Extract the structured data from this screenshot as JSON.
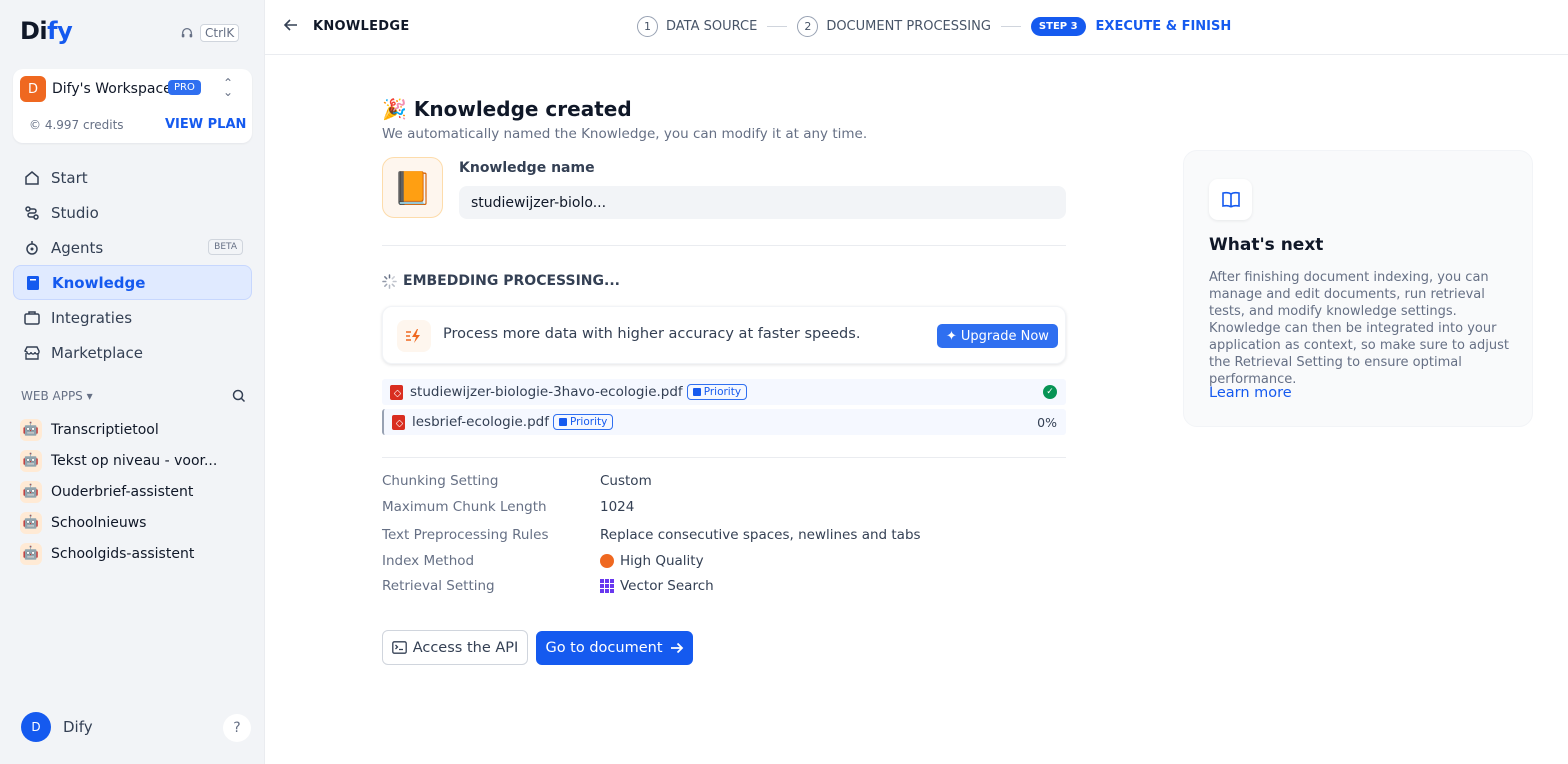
{
  "sidebar": {
    "logo": {
      "part1": "Di",
      "part2": "fy"
    },
    "shortcut": "CtrlK",
    "workspace": {
      "avatar": "D",
      "name": "Dify's Workspace",
      "plan": "PRO",
      "credits": "4.997 credits",
      "view_plan": "VIEW PLAN"
    },
    "nav": [
      {
        "label": "Start",
        "icon": "home-icon"
      },
      {
        "label": "Studio",
        "icon": "studio-icon"
      },
      {
        "label": "Agents",
        "icon": "agent-icon",
        "badge": "BETA"
      },
      {
        "label": "Knowledge",
        "icon": "book-icon",
        "active": true
      },
      {
        "label": "Integraties",
        "icon": "briefcase-icon"
      },
      {
        "label": "Marketplace",
        "icon": "store-icon"
      }
    ],
    "web_apps_header": "WEB APPS",
    "web_apps": [
      {
        "label": "Transcriptietool",
        "icon": "robot-emoji"
      },
      {
        "label": "Tekst op niveau - voor...",
        "icon": "robot-emoji"
      },
      {
        "label": "Ouderbrief-assistent",
        "icon": "robot-emoji"
      },
      {
        "label": "Schoolnieuws",
        "icon": "robot-emoji"
      },
      {
        "label": "Schoolgids-assistent",
        "icon": "robot-emoji"
      }
    ],
    "user": {
      "avatar": "D",
      "name": "Dify"
    },
    "help": "?"
  },
  "topbar": {
    "back_title": "KNOWLEDGE",
    "steps": [
      {
        "num": "1",
        "label": "DATA SOURCE"
      },
      {
        "num": "2",
        "label": "DOCUMENT PROCESSING"
      }
    ],
    "active_step": {
      "badge": "STEP 3",
      "label": "EXECUTE & FINISH"
    }
  },
  "main": {
    "title_emoji": "🎉",
    "title": "Knowledge created",
    "subtitle": "We automatically named the Knowledge, you can modify it at any time.",
    "knowledge_icon": "📙",
    "knowledge_name_label": "Knowledge name",
    "knowledge_name_value": "studiewijzer-biolo...",
    "embedding_title": "EMBEDDING PROCESSING...",
    "upgrade": {
      "text": "Process more data with higher accuracy at faster speeds.",
      "button": "Upgrade Now"
    },
    "files": [
      {
        "name": "studiewijzer-biologie-3havo-ecologie.pdf",
        "badge": "Priority",
        "status": "done"
      },
      {
        "name": "lesbrief-ecologie.pdf",
        "badge": "Priority",
        "status": "0%"
      }
    ],
    "settings": [
      {
        "key": "Chunking Setting",
        "value": "Custom"
      },
      {
        "key": "Maximum Chunk Length",
        "value": "1024"
      },
      {
        "key": "Text Preprocessing Rules",
        "value": "Replace consecutive spaces, newlines and tabs"
      },
      {
        "key": "Index Method",
        "value": "High Quality"
      },
      {
        "key": "Retrieval Setting",
        "value": "Vector Search"
      }
    ],
    "btn_api": "Access the API",
    "btn_doc": "Go to document"
  },
  "next_panel": {
    "title": "What's next",
    "body": "After finishing document indexing, you can manage and edit documents, run retrieval tests, and modify knowledge settings. Knowledge can then be integrated into your application as context, so make sure to adjust the Retrieval Setting to ensure optimal performance.",
    "link": "Learn more"
  },
  "colors": {
    "accent": "#155aef",
    "sidebar_bg": "#f2f4f7",
    "success": "#079455",
    "pdf": "#d92d20"
  }
}
